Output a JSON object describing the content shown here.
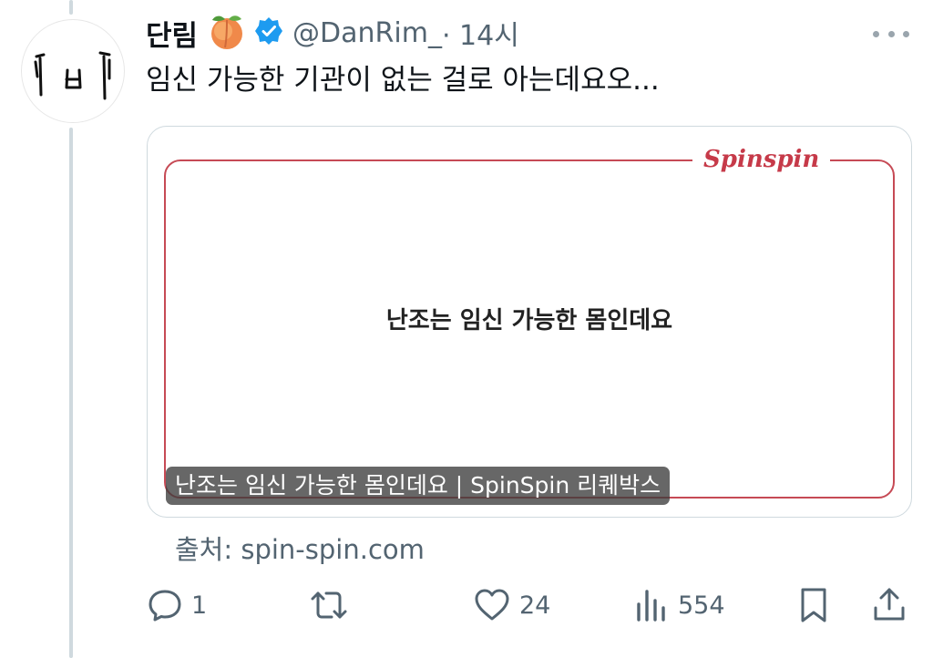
{
  "tweet": {
    "author_name": "단림",
    "author_emoji": "peach",
    "verified": true,
    "handle": "@DanRim_",
    "time": " · 14시",
    "text": "임신 가능한 기관이 없는 걸로 아는데요오...",
    "avatar_text": "ㅣㅂㅣ"
  },
  "card": {
    "logo_text": "Spinspin",
    "headline": "난조는 임신 가능한 몸인데요",
    "caption": "난조는 임신 가능한 몸인데요 | SpinSpin 리퀘박스",
    "frame_color": "#c64a55"
  },
  "source": "출처: spin-spin.com",
  "actions": {
    "reply_icon": "reply-icon",
    "reply_count": "1",
    "retweet_icon": "retweet-icon",
    "retweet_count": "",
    "like_icon": "heart-icon",
    "like_count": "24",
    "views_icon": "views-icon",
    "views_count": "554",
    "bookmark_icon": "bookmark-icon",
    "share_icon": "share-icon"
  },
  "colors": {
    "text": "#0f1419",
    "secondary": "#536471",
    "verified": "#1d9bf0",
    "thread_line": "#cfd9de"
  }
}
